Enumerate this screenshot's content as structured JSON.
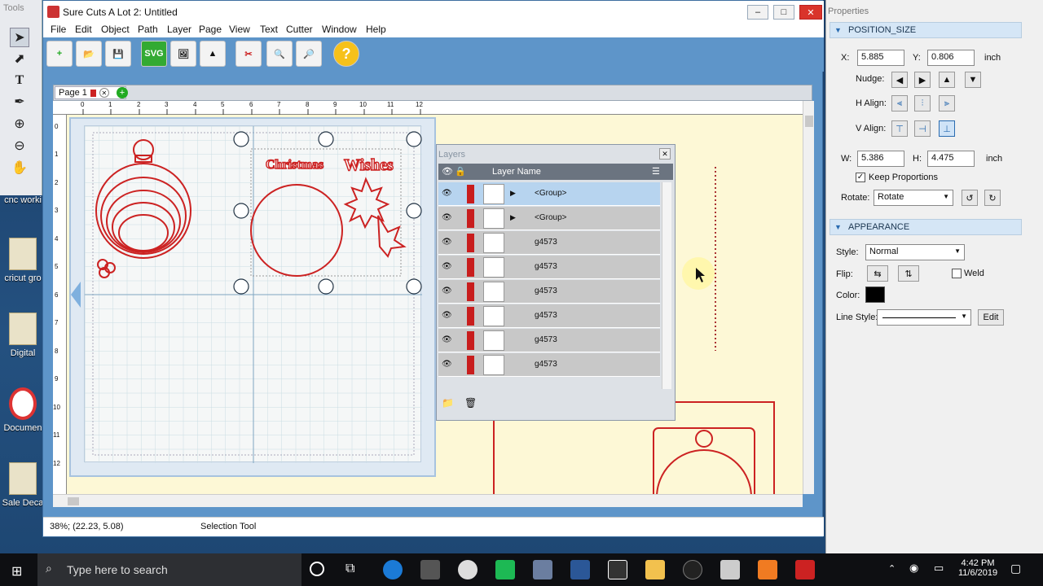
{
  "desktop": {
    "icons": [
      {
        "label": "cnc worki"
      },
      {
        "label": "cricut gro"
      },
      {
        "label": "Digital"
      },
      {
        "label": "Documen"
      },
      {
        "label": "Sale Deca"
      }
    ]
  },
  "tools": {
    "title": "Tools"
  },
  "window": {
    "title": "Sure Cuts A Lot 2: Untitled",
    "controls": {
      "minimize": "–",
      "maximize": "□",
      "close": "✕"
    }
  },
  "menu": [
    "File",
    "Edit",
    "Object",
    "Path",
    "Layer",
    "Page",
    "View",
    "Text",
    "Cutter",
    "Window",
    "Help"
  ],
  "toolbar": {
    "svg_label": "SVG",
    "help_label": "?"
  },
  "page_tab": {
    "label": "Page 1"
  },
  "ruler": {
    "top": [
      "0",
      "1",
      "2",
      "3",
      "4",
      "5",
      "6",
      "7",
      "8",
      "9",
      "10",
      "11",
      "12"
    ],
    "left": [
      "0",
      "1",
      "2",
      "3",
      "4",
      "5",
      "6",
      "7",
      "8",
      "9",
      "10",
      "11",
      "12"
    ]
  },
  "design": {
    "text1": "Christmas",
    "text2": "Wishes"
  },
  "status": {
    "coords": "38%; (22.23, 5.08)",
    "tool": "Selection Tool"
  },
  "layers": {
    "title": "Layers",
    "header": "Layer Name",
    "rows": [
      {
        "name": "<Group>",
        "selected": true
      },
      {
        "name": "<Group>",
        "selected": false
      },
      {
        "name": "g4573",
        "selected": false
      },
      {
        "name": "g4573",
        "selected": false
      },
      {
        "name": "g4573",
        "selected": false
      },
      {
        "name": "g4573",
        "selected": false
      },
      {
        "name": "g4573",
        "selected": false
      },
      {
        "name": "g4573",
        "selected": false
      }
    ]
  },
  "properties": {
    "title": "Properties",
    "position_size": {
      "header": "POSITION_SIZE",
      "x_label": "X:",
      "x_value": "5.885",
      "y_label": "Y:",
      "y_value": "0.806",
      "unit": "inch",
      "nudge_label": "Nudge:",
      "halign_label": "H Align:",
      "valign_label": "V Align:",
      "w_label": "W:",
      "w_value": "5.386",
      "h_label": "H:",
      "h_value": "4.475",
      "unit2": "inch",
      "keep_proportions": "Keep Proportions",
      "rotate_label": "Rotate:",
      "rotate_value": "Rotate"
    },
    "appearance": {
      "header": "APPEARANCE",
      "style_label": "Style:",
      "style_value": "Normal",
      "flip_label": "Flip:",
      "weld_label": "Weld",
      "color_label": "Color:",
      "color_value": "#000000",
      "line_style_label": "Line Style:",
      "edit_label": "Edit"
    }
  },
  "taskbar": {
    "search_placeholder": "Type here to search",
    "time": "4:42 PM",
    "date": "11/6/2019"
  }
}
